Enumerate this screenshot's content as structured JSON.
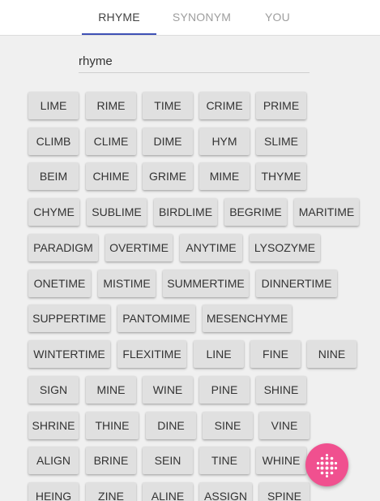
{
  "tabs": {
    "rhyme": "RHYME",
    "synonym": "SYNONYM",
    "you": "YOU"
  },
  "search": {
    "value": "rhyme"
  },
  "words": [
    [
      "LIME",
      "RIME",
      "TIME",
      "CRIME",
      "PRIME"
    ],
    [
      "CLIMB",
      "CLIME",
      "DIME",
      "HYM",
      "SLIME"
    ],
    [
      "BEIM",
      "CHIME",
      "GRIME",
      "MIME",
      "THYME"
    ],
    [
      "CHYME",
      "SUBLIME",
      "BIRDLIME",
      "BEGRIME",
      "MARITIME"
    ],
    [
      "PARADIGM",
      "OVERTIME",
      "ANYTIME",
      "LYSOZYME"
    ],
    [
      "ONETIME",
      "MISTIME",
      "SUMMERTIME",
      "DINNERTIME"
    ],
    [
      "SUPPERTIME",
      "PANTOMIME",
      "MESENCHYME"
    ],
    [
      "WINTERTIME",
      "FLEXITIME",
      "LINE",
      "FINE",
      "NINE"
    ],
    [
      "SIGN",
      "MINE",
      "WINE",
      "PINE",
      "SHINE"
    ],
    [
      "SHRINE",
      "THINE",
      "DINE",
      "SINE",
      "VINE"
    ],
    [
      "ALIGN",
      "BRINE",
      "SEIN",
      "TINE",
      "WHINE"
    ],
    [
      "HEING",
      "ZINE",
      "ALINE",
      "ASSIGN",
      "SPINE"
    ]
  ],
  "fab": {
    "icon": "dots-grid-icon",
    "color": "#f0508f"
  },
  "colors": {
    "accent": "#3f51b5",
    "button_bg": "#e0e0e0"
  }
}
